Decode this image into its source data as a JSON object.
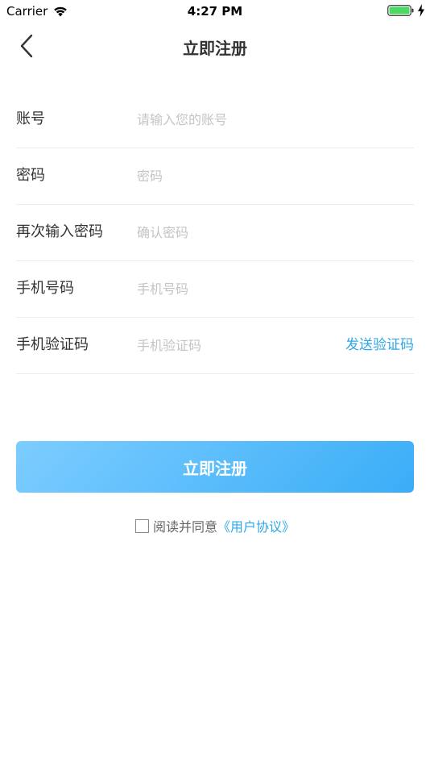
{
  "status_bar": {
    "carrier": "Carrier",
    "time": "4:27 PM",
    "battery_color": "#4cd964"
  },
  "nav": {
    "title": "立即注册",
    "back_icon": "chevron-left-icon"
  },
  "form": {
    "rows": [
      {
        "label": "账号",
        "placeholder": "请输入您的账号",
        "value": ""
      },
      {
        "label": "密码",
        "placeholder": "密码",
        "value": ""
      },
      {
        "label": "再次输入密码",
        "placeholder": "确认密码",
        "value": ""
      },
      {
        "label": "手机号码",
        "placeholder": "手机号码",
        "value": ""
      },
      {
        "label": "手机验证码",
        "placeholder": "手机验证码",
        "value": ""
      }
    ],
    "send_code_label": "发送验证码"
  },
  "register_button_label": "立即注册",
  "agreement": {
    "checked": false,
    "text": "阅读并同意",
    "link": "《用户协议》"
  },
  "colors": {
    "accent": "#2fa8e8",
    "button_gradient_start": "#7dcdff",
    "button_gradient_end": "#3aadf7",
    "placeholder": "#c4c4c4",
    "divider": "#ececec"
  }
}
